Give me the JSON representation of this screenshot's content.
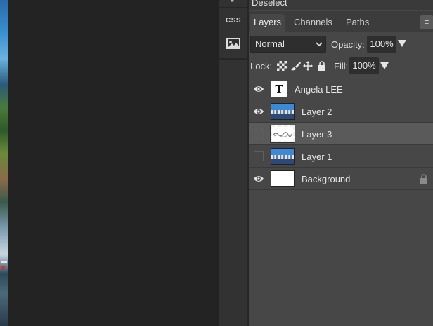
{
  "menu": {
    "deselect_label": "Deselect"
  },
  "toolbar": {
    "css_label": "CSS",
    "image_icon": "image-icon"
  },
  "tabs": [
    {
      "label": "Layers",
      "active": true
    },
    {
      "label": "Channels",
      "active": false
    },
    {
      "label": "Paths",
      "active": false
    }
  ],
  "tab_menu_label": "≡",
  "blend_mode": {
    "value": "Normal"
  },
  "opacity": {
    "label": "Opacity:",
    "value": "100%"
  },
  "lock": {
    "label": "Lock:",
    "icons": [
      "checkerboard-icon",
      "brush-icon",
      "move-icon",
      "lock-icon"
    ]
  },
  "fill": {
    "label": "Fill:",
    "value": "100%"
  },
  "layers": [
    {
      "name": "Angela LEE",
      "visible": true,
      "type": "text",
      "thumb_label": "T",
      "selected": false,
      "locked": false
    },
    {
      "name": "Layer 2",
      "visible": true,
      "type": "image",
      "selected": false,
      "locked": false
    },
    {
      "name": "Layer 3",
      "visible": false,
      "type": "mask",
      "selected": true,
      "locked": false
    },
    {
      "name": "Layer 1",
      "visible": false,
      "type": "image",
      "selected": false,
      "locked": false
    },
    {
      "name": "Background",
      "visible": true,
      "type": "fill",
      "selected": false,
      "locked": true
    }
  ],
  "colors": {
    "panel_bg": "#474747",
    "selected_row": "#5a5a5a",
    "workspace_bg": "#232323",
    "input_bg": "#2e2e2e"
  }
}
